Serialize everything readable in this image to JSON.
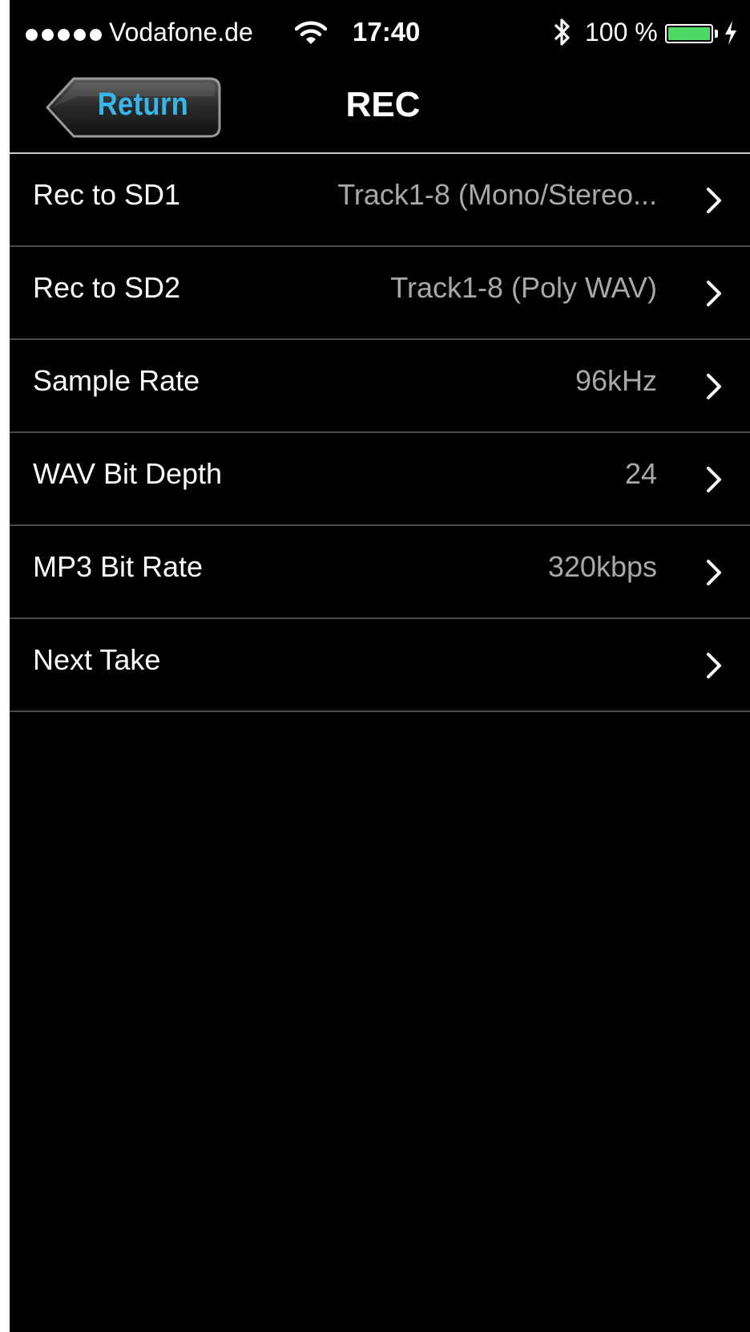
{
  "status_bar": {
    "carrier": "Vodafone.de",
    "time": "17:40",
    "battery_percent": "100 %",
    "battery_level": 1.0,
    "battery_color": "#4cd964",
    "signal_bars": 5,
    "icons": [
      "wifi-icon",
      "bluetooth-icon",
      "battery-icon",
      "charging-icon"
    ]
  },
  "nav": {
    "back_label": "Return",
    "back_label_color": "#38b6ea",
    "title": "REC"
  },
  "settings": [
    {
      "label": "Rec to SD1",
      "value": "Track1-8 (Mono/Stereo..."
    },
    {
      "label": "Rec to SD2",
      "value": "Track1-8 (Poly WAV)"
    },
    {
      "label": "Sample Rate",
      "value": "96kHz"
    },
    {
      "label": "WAV Bit Depth",
      "value": "24"
    },
    {
      "label": "MP3 Bit Rate",
      "value": "320kbps"
    },
    {
      "label": "Next Take",
      "value": ""
    }
  ]
}
